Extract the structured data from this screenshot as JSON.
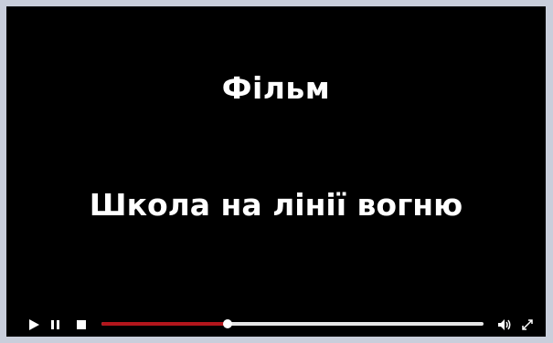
{
  "video": {
    "title_line_1": "Фільм",
    "title_line_2": "Школа на лінії вогню"
  },
  "controls": {
    "play_icon": "play-icon",
    "pause_icon": "pause-icon",
    "stop_icon": "stop-icon",
    "volume_icon": "volume-icon",
    "fullscreen_icon": "fullscreen-icon",
    "progress_fraction": 0.33
  },
  "colors": {
    "background": "#000000",
    "text": "#ffffff",
    "progress_played": "#b3161c",
    "progress_track": "#e6e6e6",
    "frame": "#c9cedb"
  }
}
